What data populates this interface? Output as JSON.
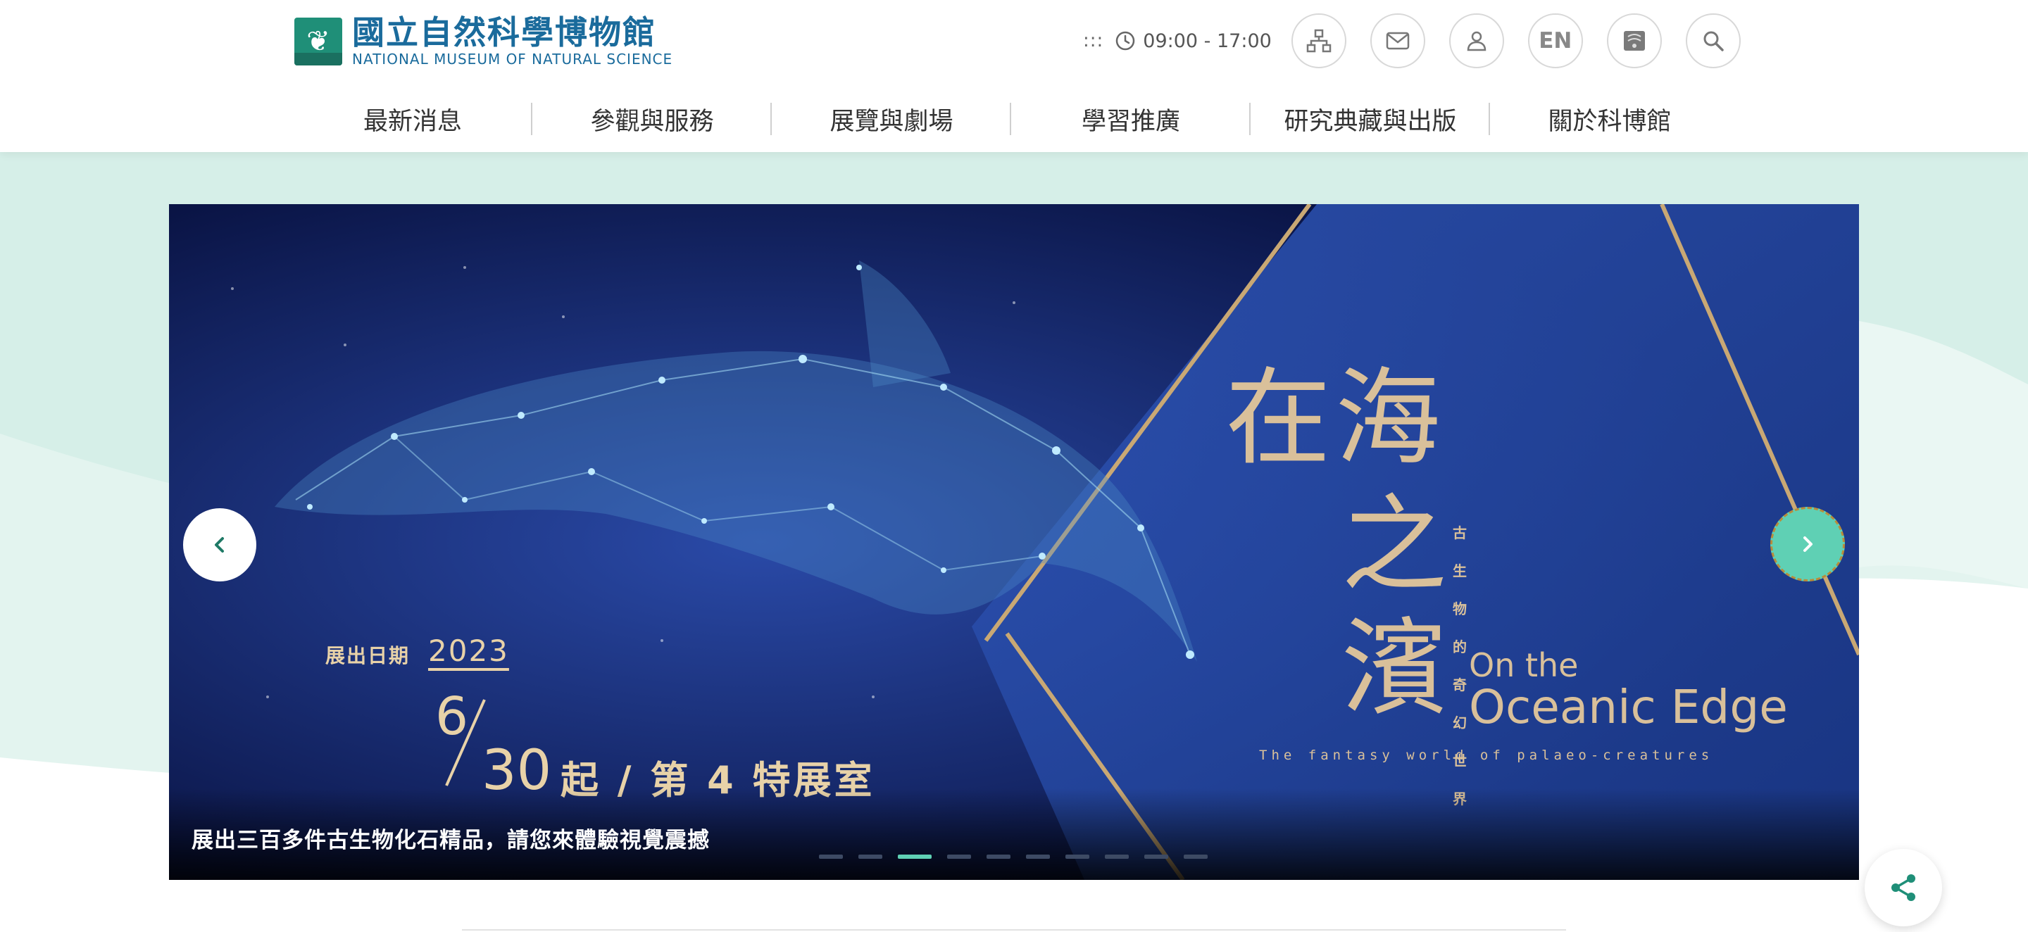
{
  "header": {
    "logo_cn": "國立自然科學博物館",
    "logo_en": "NATIONAL MUSEUM OF NATURAL SCIENCE",
    "accessibility_key": ":::",
    "hours": "09:00 - 17:00",
    "lang": "EN",
    "icons": [
      "sitemap-icon",
      "mail-icon",
      "user-icon",
      "language-icon",
      "book-icon",
      "search-icon"
    ]
  },
  "nav": {
    "items": [
      "最新消息",
      "參觀與服務",
      "展覽與劇場",
      "學習推廣",
      "研究典藏與出版",
      "關於科博館"
    ]
  },
  "banner": {
    "dates_label": "展出日期",
    "year": "2023",
    "month": "6",
    "day": "30",
    "date_rest": "起 / 第 4 特展室",
    "title_cn_1": "在海",
    "title_cn_2": "之",
    "title_cn_3": "濱",
    "title_sub": "古生物的奇幻世界",
    "title_en_1": "On the",
    "title_en_2": "Oceanic Edge",
    "tagline": "The fantasy world of palaeo-creatures",
    "caption": "展出三百多件古生物化石精品，請您來體驗視覺震撼",
    "slide_count": 10,
    "active_slide": 3
  },
  "colors": {
    "brand": "#1a6b9c",
    "accent": "#5fd0b4",
    "gold": "#d9c09a",
    "banner_bg": "#0e1a55"
  }
}
